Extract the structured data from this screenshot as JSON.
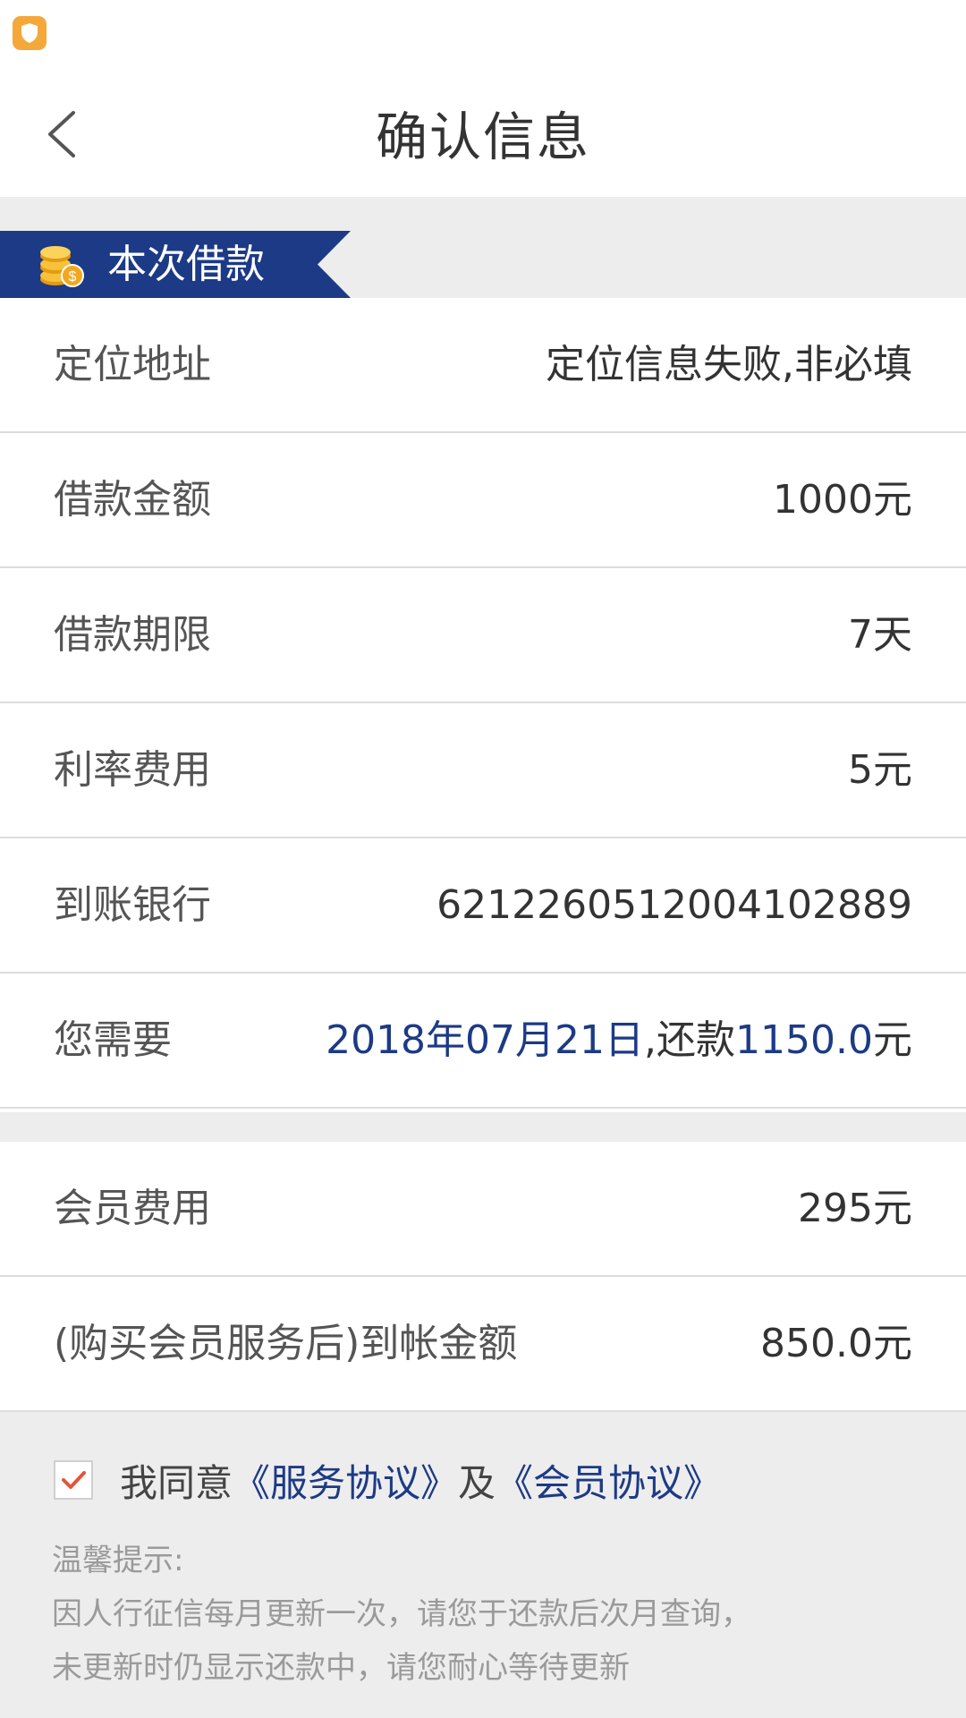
{
  "status_bar": {
    "notification_icon": "shield-icon"
  },
  "header": {
    "title": "确认信息",
    "back_icon": "chevron-left-icon"
  },
  "section": {
    "title": "本次借款",
    "icon": "coins-icon",
    "banner_color": "#1c3a86"
  },
  "loan_rows": [
    {
      "label": "定位地址",
      "value": "定位信息失败,非必填"
    },
    {
      "label": "借款金额",
      "value": "1000元"
    },
    {
      "label": "借款期限",
      "value": "7天"
    },
    {
      "label": "利率费用",
      "value": "5元"
    },
    {
      "label": "到账银行",
      "value": "6212260512004102889"
    },
    {
      "label": "您需要",
      "value_parts": {
        "date": "2018年07月21日",
        "mid": ",还款",
        "amount": "1150.0",
        "unit": "元"
      }
    }
  ],
  "member_rows": [
    {
      "label": "会员费用",
      "value": "295元"
    },
    {
      "label": "(购买会员服务后)到帐金额",
      "value": "850.0元"
    }
  ],
  "agreement": {
    "checked": true,
    "prefix": "我同意",
    "service_link": "《服务协议》",
    "conjunction": "及",
    "member_link": "《会员协议》"
  },
  "tips": {
    "title": "温馨提示:",
    "line1": "因人行征信每月更新一次，请您于还款后次月查询，",
    "line2": "未更新时仍显示还款中，请您耐心等待更新"
  },
  "colors": {
    "accent": "#1c3a86",
    "check": "#e2553a",
    "background": "#ededed"
  }
}
